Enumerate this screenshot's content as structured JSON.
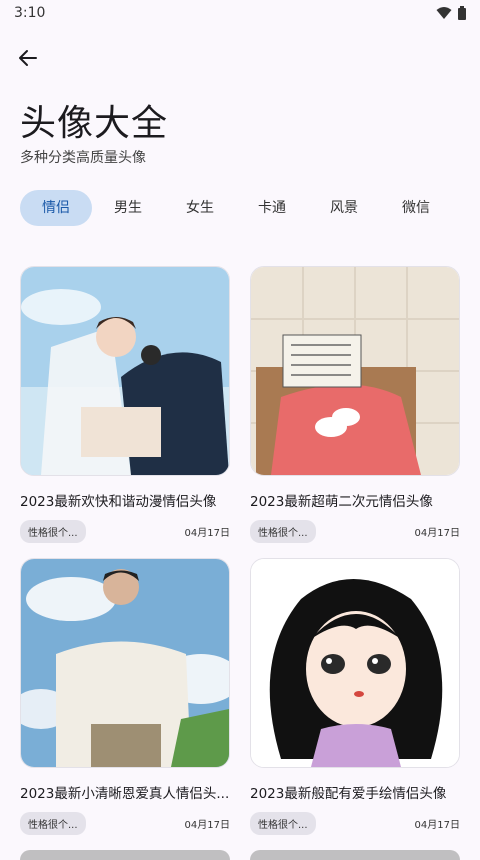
{
  "status": {
    "time": "3:10"
  },
  "header": {
    "title": "头像大全",
    "subtitle": "多种分类高质量头像"
  },
  "tabs": [
    {
      "label": "情侣",
      "active": true
    },
    {
      "label": "男生",
      "active": false
    },
    {
      "label": "女生",
      "active": false
    },
    {
      "label": "卡通",
      "active": false
    },
    {
      "label": "风景",
      "active": false
    },
    {
      "label": "微信",
      "active": false
    }
  ],
  "cards": [
    {
      "title": "2023最新欢快和谐动漫情侣头像",
      "tag": "性格很个...",
      "date": "04月17日"
    },
    {
      "title": "2023最新超萌二次元情侣头像",
      "tag": "性格很个...",
      "date": "04月17日"
    },
    {
      "title": "2023最新小清晰恩爱真人情侣头...",
      "tag": "性格很个...",
      "date": "04月17日"
    },
    {
      "title": "2023最新般配有爱手绘情侣头像",
      "tag": "性格很个...",
      "date": "04月17日"
    }
  ],
  "colors": {
    "accent": "#1a59a8",
    "tab_active_bg": "#c9dcf3",
    "background": "#fbf8fd"
  }
}
